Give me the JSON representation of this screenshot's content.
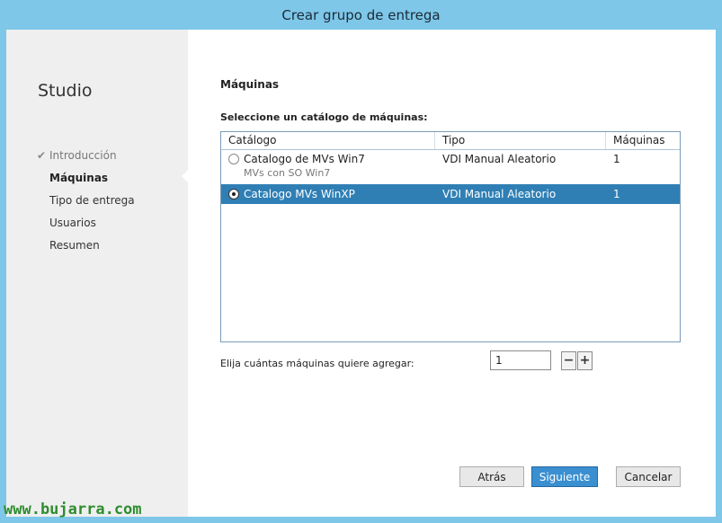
{
  "window": {
    "title": "Crear grupo de entrega"
  },
  "sidebar": {
    "brand": "Studio",
    "steps": [
      {
        "label": "Introducción",
        "state": "done"
      },
      {
        "label": "Máquinas",
        "state": "current"
      },
      {
        "label": "Tipo de entrega",
        "state": "pending"
      },
      {
        "label": "Usuarios",
        "state": "pending"
      },
      {
        "label": "Resumen",
        "state": "pending"
      }
    ]
  },
  "main": {
    "heading": "Máquinas",
    "catalog_prompt": "Seleccione un catálogo de máquinas:",
    "table": {
      "columns": [
        "Catálogo",
        "Tipo",
        "Máquinas"
      ],
      "rows": [
        {
          "name": "Catalogo de MVs Win7",
          "description": "MVs con SO Win7",
          "type": "VDI Manual Aleatorio",
          "machines": "1",
          "selected": false
        },
        {
          "name": "Catalogo MVs WinXP",
          "description": "",
          "type": "VDI Manual Aleatorio",
          "machines": "1",
          "selected": true
        }
      ]
    },
    "count_prompt": "Elija cuántas máquinas quiere agregar:",
    "count_value": "1",
    "stepper": {
      "minus": "−",
      "plus": "+"
    }
  },
  "buttons": {
    "back": "Atrás",
    "next": "Siguiente",
    "cancel": "Cancelar"
  },
  "watermark": "www.bujarra.com",
  "colors": {
    "selection": "#2f7fb5",
    "primary_button": "#3a8fd0",
    "frame": "#7ec7e9"
  }
}
